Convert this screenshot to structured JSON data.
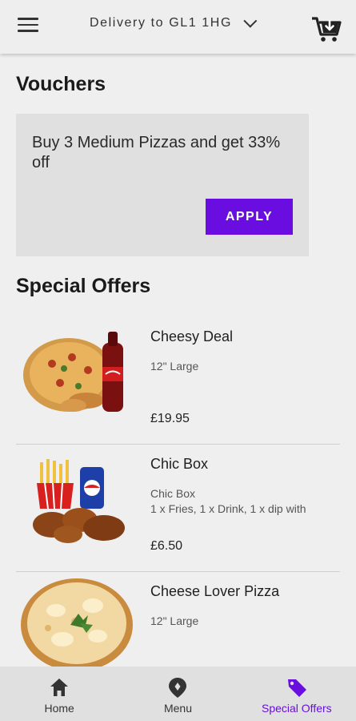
{
  "header": {
    "delivery_label": "Delivery to GL1 1HG"
  },
  "vouchers": {
    "title": "Vouchers",
    "card_text": "Buy 3 Medium Pizzas and get 33% off",
    "apply_label": "APPLY"
  },
  "special_offers": {
    "title": "Special Offers",
    "items": [
      {
        "name": "Cheesy Deal",
        "description": "12\" Large",
        "price": "£19.95"
      },
      {
        "name": "Chic Box",
        "description": "Chic Box\n1 x Fries, 1 x Drink, 1 x dip with",
        "price": "£6.50"
      },
      {
        "name": "Cheese Lover Pizza",
        "description": "12\" Large",
        "price": ""
      }
    ]
  },
  "nav": {
    "items": [
      {
        "label": "Home",
        "icon": "home-icon"
      },
      {
        "label": "Menu",
        "icon": "map-pin-icon"
      },
      {
        "label": "Special Offers",
        "icon": "tag-icon"
      }
    ],
    "active_color": "#6a0de0"
  },
  "colors": {
    "accent": "#6a0de0",
    "background": "#efefef",
    "card": "#e0e0e0"
  }
}
